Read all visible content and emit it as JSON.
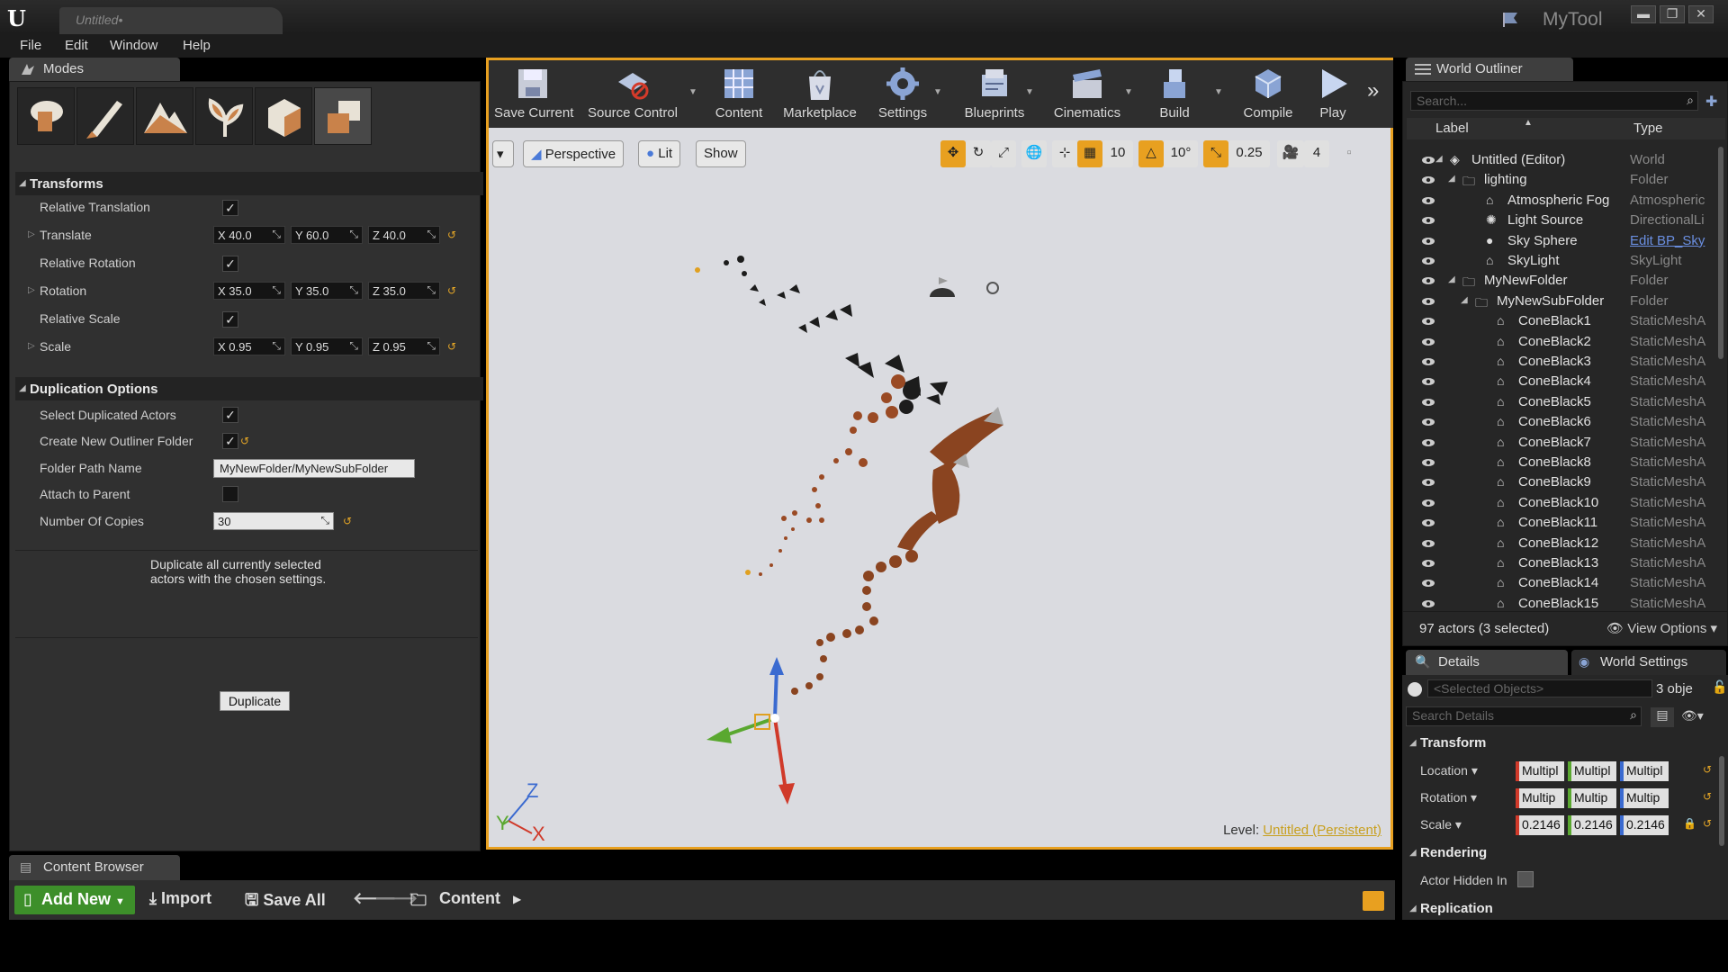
{
  "title_bar": {
    "doc_tab": "Untitled•",
    "app_name": "MyTool",
    "min": "▬",
    "max": "❐",
    "close": "✕"
  },
  "menu": [
    "File",
    "Edit",
    "Window",
    "Help"
  ],
  "modes": {
    "tab_label": "Modes",
    "transforms": {
      "title": "Transforms",
      "relative_translation": "Relative Translation",
      "translate": "Translate",
      "relative_rotation": "Relative Rotation",
      "rotation": "Rotation",
      "relative_scale": "Relative Scale",
      "scale": "Scale",
      "translate_values": [
        "X  40.0",
        "Y  60.0",
        "Z  40.0"
      ],
      "rotation_values": [
        "X  35.0",
        "Y  35.0",
        "Z  35.0"
      ],
      "scale_values": [
        "X  0.95",
        "Y  0.95",
        "Z  0.95"
      ]
    },
    "duplication": {
      "title": "Duplication Options",
      "select_duplicated": "Select Duplicated Actors",
      "create_folder": "Create New Outliner Folder",
      "folder_path_label": "Folder Path Name",
      "folder_path_value": "MyNewFolder/MyNewSubFolder",
      "attach_parent": "Attach to Parent",
      "copies_label": "Number Of Copies",
      "copies_value": "30"
    },
    "description": "Duplicate all currently selected actors with the chosen settings.",
    "duplicate_button": "Duplicate"
  },
  "toolbar": {
    "save_current": "Save Current",
    "source_control": "Source Control",
    "content": "Content",
    "marketplace": "Marketplace",
    "settings": "Settings",
    "blueprints": "Blueprints",
    "cinematics": "Cinematics",
    "build": "Build",
    "compile": "Compile",
    "play": "Play"
  },
  "viewport": {
    "perspective": "Perspective",
    "lit": "Lit",
    "show": "Show",
    "grid_snap": "10",
    "rot_snap": "10°",
    "scale_snap": "0.25",
    "camera_speed": "4",
    "level_prefix": "Level:",
    "level_name": "Untitled (Persistent)",
    "axis_z": "Z",
    "axis_x": "X",
    "axis_y": "Y"
  },
  "outliner": {
    "tab_label": "World Outliner",
    "search_placeholder": "Search...",
    "col_label": "Label",
    "col_type": "Type",
    "rows": [
      {
        "label": "Untitled (Editor)",
        "type": "World"
      },
      {
        "label": "lighting",
        "type": "Folder"
      },
      {
        "label": "Atmospheric Fog",
        "type": "Atmospheric"
      },
      {
        "label": "Light Source",
        "type": "DirectionalLi"
      },
      {
        "label": "Sky Sphere",
        "type": "Edit BP_Sky"
      },
      {
        "label": "SkyLight",
        "type": "SkyLight"
      },
      {
        "label": "MyNewFolder",
        "type": "Folder"
      },
      {
        "label": "MyNewSubFolder",
        "type": "Folder"
      },
      {
        "label": "ConeBlack1",
        "type": "StaticMeshA"
      },
      {
        "label": "ConeBlack2",
        "type": "StaticMeshA"
      },
      {
        "label": "ConeBlack3",
        "type": "StaticMeshA"
      },
      {
        "label": "ConeBlack4",
        "type": "StaticMeshA"
      },
      {
        "label": "ConeBlack5",
        "type": "StaticMeshA"
      },
      {
        "label": "ConeBlack6",
        "type": "StaticMeshA"
      },
      {
        "label": "ConeBlack7",
        "type": "StaticMeshA"
      },
      {
        "label": "ConeBlack8",
        "type": "StaticMeshA"
      },
      {
        "label": "ConeBlack9",
        "type": "StaticMeshA"
      },
      {
        "label": "ConeBlack10",
        "type": "StaticMeshA"
      },
      {
        "label": "ConeBlack11",
        "type": "StaticMeshA"
      },
      {
        "label": "ConeBlack12",
        "type": "StaticMeshA"
      },
      {
        "label": "ConeBlack13",
        "type": "StaticMeshA"
      },
      {
        "label": "ConeBlack14",
        "type": "StaticMeshA"
      },
      {
        "label": "ConeBlack15",
        "type": "StaticMeshA"
      }
    ],
    "actor_count": "97 actors (3 selected)",
    "view_options": "View Options"
  },
  "details": {
    "tab_details": "Details",
    "tab_world_settings": "World Settings",
    "selected_objects": "<Selected Objects>",
    "obj_count": "3 obje",
    "search_placeholder": "Search Details",
    "transform": "Transform",
    "location": "Location",
    "rotation": "Rotation",
    "scale": "Scale",
    "multi": "Multipl",
    "rot_multi": "Multip",
    "scale_val": "0.2146",
    "rendering": "Rendering",
    "actor_hidden": "Actor Hidden In",
    "replication": "Replication"
  },
  "content_browser": {
    "tab_label": "Content Browser",
    "add_new": "Add New",
    "import": "Import",
    "save_all": "Save All",
    "content": "Content"
  },
  "colors": {
    "accent": "#e8a020",
    "add_new_green": "#3d8f2a",
    "x_axis": "#d03a2a",
    "y_axis": "#5aa830",
    "z_axis": "#3a6ad0"
  }
}
